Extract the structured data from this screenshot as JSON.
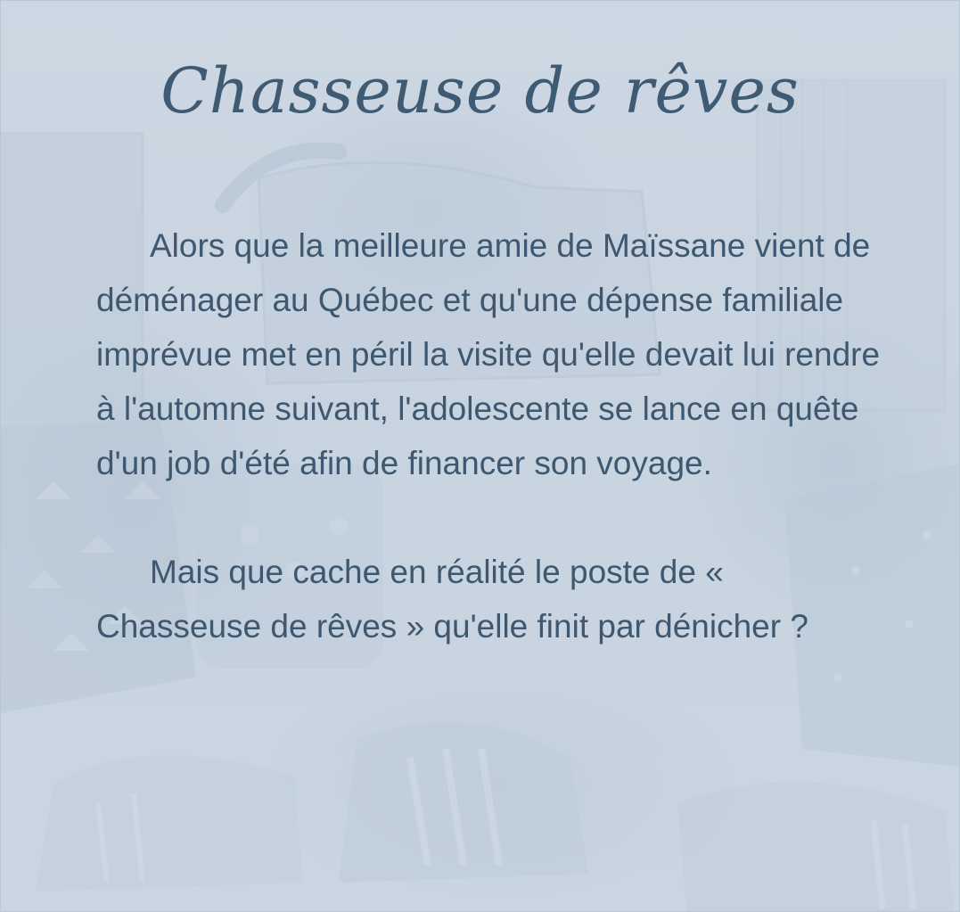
{
  "title": "Chasseuse de rêves",
  "paragraphs": [
    "Alors que la meilleure amie de Maïssane vient de déménager au Québec et qu'une dépense familiale imprévue met en péril la visite qu'elle devait lui rendre à l'automne suivant, l'adolescente se lance en quête d'un job d'été afin de financer son voyage.",
    "Mais que cache en réalité le poste de « Chasseuse de rêves » qu'elle finit par dénicher ?"
  ],
  "colors": {
    "background": "#c9d5e1",
    "text": "#3d5870",
    "title": "#3f5b73"
  }
}
